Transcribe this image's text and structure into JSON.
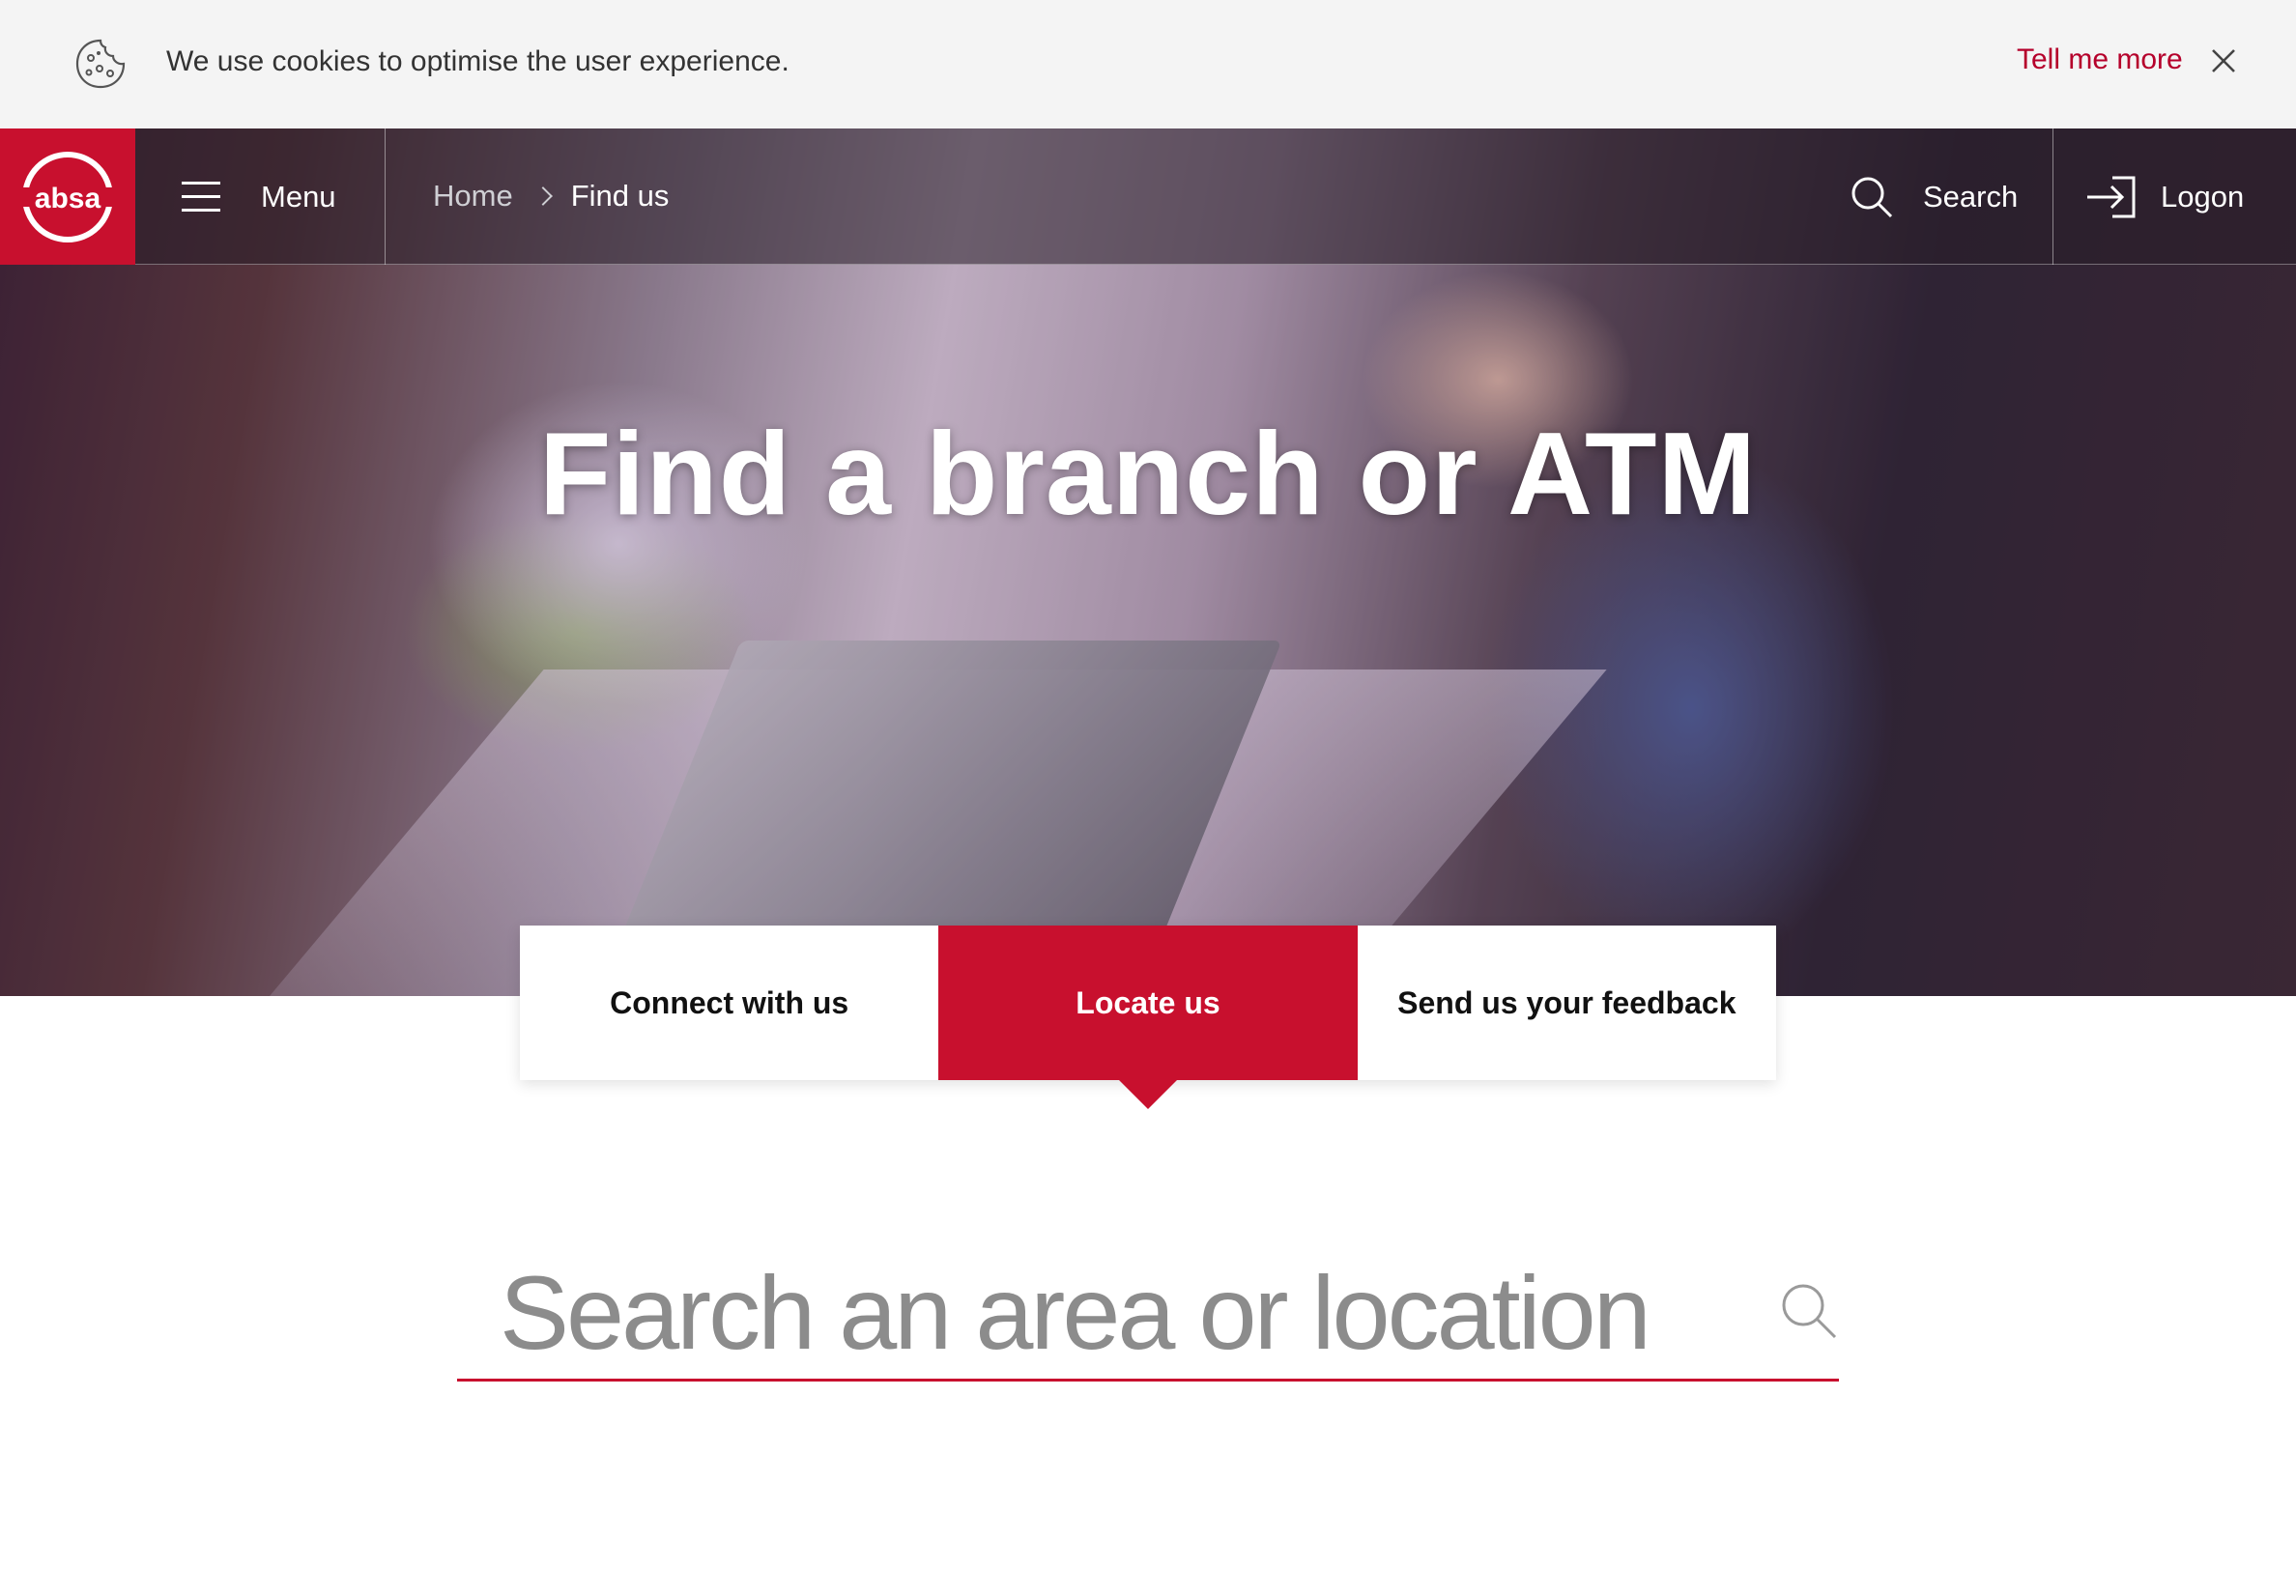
{
  "cookie_bar": {
    "icon": "cookie-icon",
    "message": "We use cookies to optimise the user experience.",
    "link_label": "Tell me more",
    "close_icon": "close-icon"
  },
  "navbar": {
    "logo_text": "absa",
    "menu_label": "Menu",
    "breadcrumb": {
      "home": "Home",
      "current": "Find us"
    },
    "search_label": "Search",
    "logon_label": "Logon"
  },
  "hero": {
    "title": "Find a branch or ATM"
  },
  "tabs": [
    {
      "label": "Connect with us",
      "active": false
    },
    {
      "label": "Locate us",
      "active": true
    },
    {
      "label": "Send us your feedback",
      "active": false
    }
  ],
  "search": {
    "placeholder": "Search an area or location",
    "value": ""
  },
  "colors": {
    "brand_red": "#c8102e",
    "link_red": "#b5002b",
    "cookie_bg": "#f4f4f4"
  }
}
